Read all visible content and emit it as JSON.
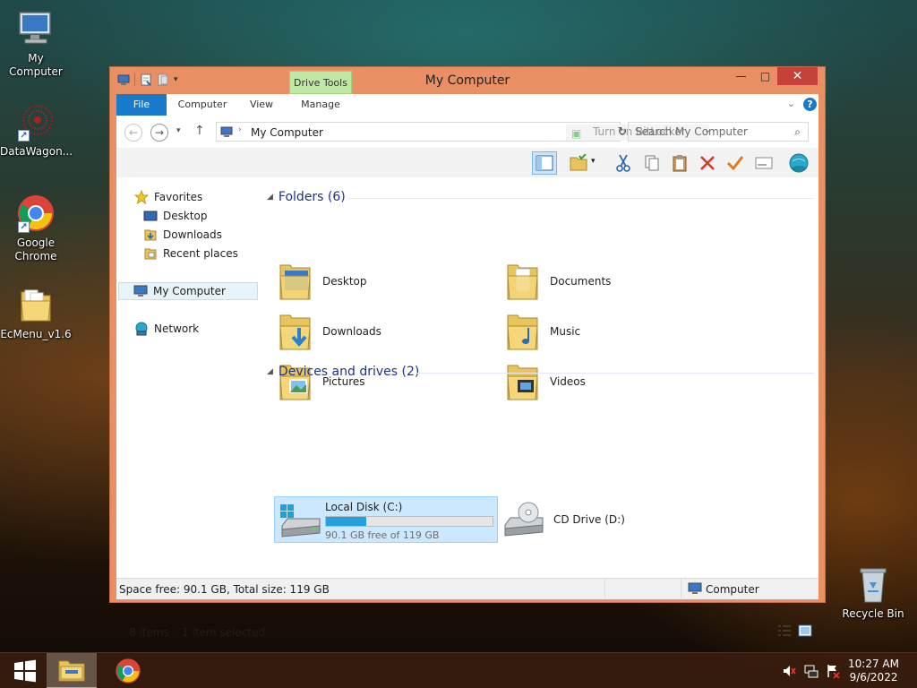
{
  "desktop": {
    "icons": [
      {
        "label": "My Computer"
      },
      {
        "label": "DataWagon..."
      },
      {
        "label": "Google Chrome"
      },
      {
        "label": "EcMenu_v1.6"
      },
      {
        "label": "Recycle Bin"
      }
    ]
  },
  "window": {
    "title": "My Computer",
    "contextual_tab": "Drive Tools",
    "tabs": [
      "File",
      "Computer",
      "View",
      "Manage"
    ],
    "controls": {
      "minimize": "—",
      "maximize": "□",
      "close": "✕"
    }
  },
  "address": {
    "crumb": "My Computer",
    "bitlocker": "Turn on BitLocker",
    "search_placeholder": "Search My Computer"
  },
  "nav": {
    "favorites": "Favorites",
    "desktop": "Desktop",
    "downloads": "Downloads",
    "recent": "Recent places",
    "computer": "My Computer",
    "network": "Network"
  },
  "folders": {
    "header": "Folders (6)",
    "items": [
      "Desktop",
      "Documents",
      "Downloads",
      "Music",
      "Pictures",
      "Videos"
    ]
  },
  "drives": {
    "header": "Devices and drives (2)",
    "local": {
      "name": "Local Disk (C:)",
      "free": "90.1 GB free of 119 GB",
      "used_fraction": 0.243
    },
    "cd": {
      "name": "CD Drive (D:)"
    }
  },
  "status": {
    "items": "8 items",
    "selected": "1 item selected",
    "space": "Space free: 90.1 GB, Total size: 119 GB",
    "location": "Computer"
  },
  "taskbar": {
    "time": "10:27 AM",
    "date": "9/6/2022"
  },
  "colors": {
    "titlebar": "#e88f63",
    "accent": "#1979ca",
    "selection": "#cce8ff",
    "drive_bar": "#26a0da"
  }
}
